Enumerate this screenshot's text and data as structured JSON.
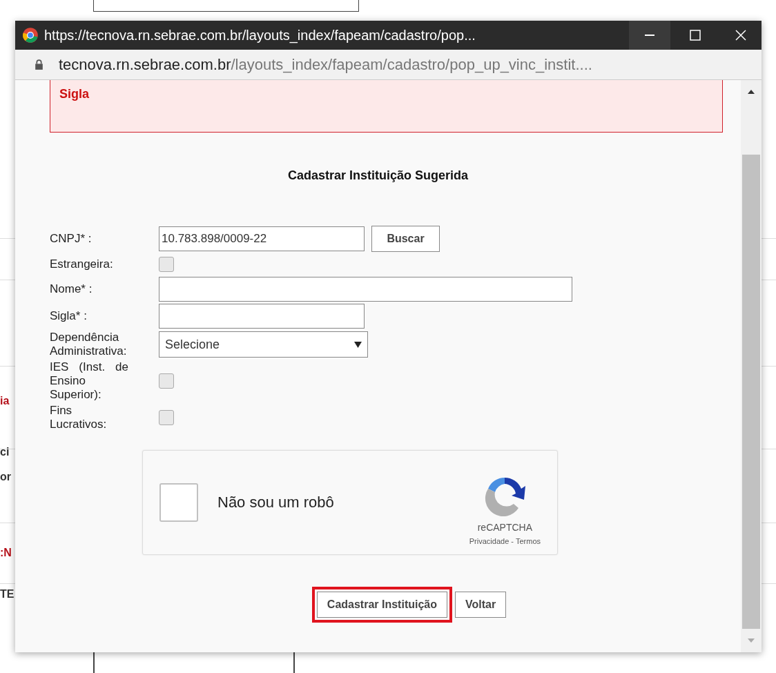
{
  "background_fragments": [
    {
      "text": "ia",
      "kind": "alert"
    },
    {
      "text": "ci",
      "kind": "plain"
    },
    {
      "text": "or",
      "kind": "plain"
    },
    {
      "text": ":N",
      "kind": "alert"
    },
    {
      "text": "TE",
      "kind": "plain"
    }
  ],
  "window": {
    "title": "https://tecnova.rn.sebrae.com.br/layouts_index/fapeam/cadastro/pop...",
    "address_host": "tecnova.rn.sebrae.com.br",
    "address_path": "/layouts_index/fapeam/cadastro/pop_up_vinc_instit...."
  },
  "error_box": {
    "lines": [
      "Sigla"
    ]
  },
  "heading": "Cadastrar Instituição Sugerida",
  "fields": [
    {
      "label": "CNPJ* :",
      "kind": "text",
      "value": "10.783.898/0009-22",
      "button": "Buscar"
    },
    {
      "label": "Estrangeira:",
      "kind": "checkbox",
      "checked": false
    },
    {
      "label": "Nome* :",
      "kind": "widetext"
    },
    {
      "label": "Sigla* :",
      "kind": "text"
    },
    {
      "label": "Dependência Administrativa:",
      "kind": "select",
      "value": "Selecione"
    },
    {
      "label": "IES (Inst. de Ensino Superior):",
      "kind": "checkbox",
      "checked": false
    },
    {
      "label": "Fins Lucrativos:",
      "kind": "checkbox",
      "checked": false
    }
  ],
  "captcha": {
    "label": "Não sou um robô",
    "checked": false,
    "brand": "reCAPTCHA",
    "privacy": "Privacidade",
    "separator": "-",
    "terms": "Termos"
  },
  "buttons": [
    {
      "label": "Cadastrar Instituição",
      "highlighted": true
    },
    {
      "label": "Voltar",
      "highlighted": false
    }
  ]
}
